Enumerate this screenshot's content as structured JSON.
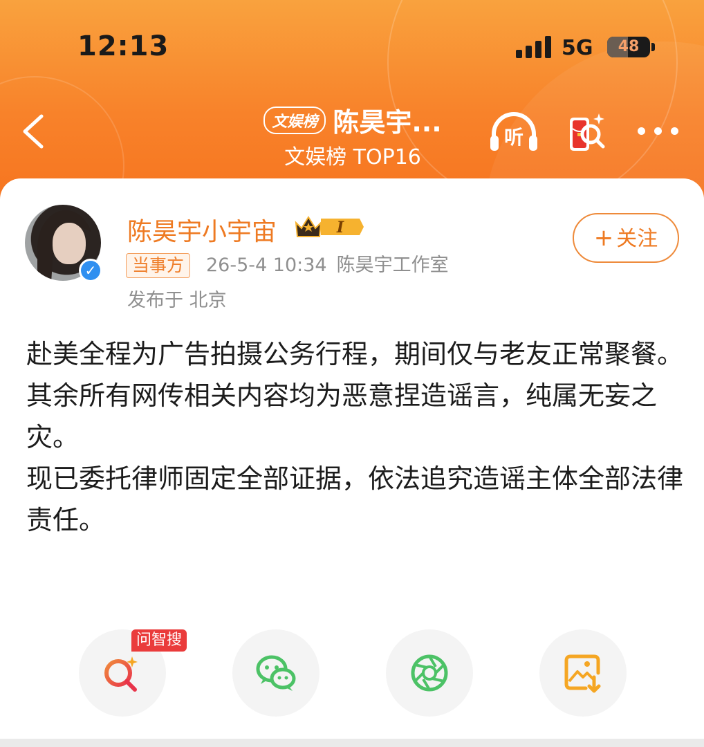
{
  "status_bar": {
    "time": "12:13",
    "network": "5G",
    "battery_percent": "48",
    "battery_level": 0.48
  },
  "nav": {
    "badge": "文娱榜",
    "title": "陈昊宇...",
    "subtitle": "文娱榜 TOP16",
    "listen_label": "听",
    "icons": [
      "back-icon",
      "headphones-icon",
      "red-envelope-search-icon",
      "more-icon"
    ]
  },
  "post": {
    "username": "陈昊宇小宇宙",
    "member_badge": "I",
    "tag": "当事方",
    "datetime": "26-5-4 10:34",
    "source": "陈昊宇工作室",
    "location": "发布于 北京",
    "follow_label": "关注",
    "paragraphs": [
      "赴美全程为广告拍摄公务行程，期间仅与老友正常聚餐。",
      "其余所有网传相关内容均为恶意捏造谣言，纯属无妄之灾。",
      "现已委托律师固定全部证据，依法追究造谣主体全部法律责任。"
    ]
  },
  "actions": {
    "ask_badge": "问智搜",
    "items": [
      "smart-search-icon",
      "wechat-icon",
      "moments-icon",
      "save-image-icon"
    ]
  },
  "colors": {
    "header_orange": "#f8822a",
    "accent": "#ee7a22",
    "verified_blue": "#2f8ff0",
    "badge_red": "#ea3b3b",
    "wechat_green": "#4cc266"
  }
}
